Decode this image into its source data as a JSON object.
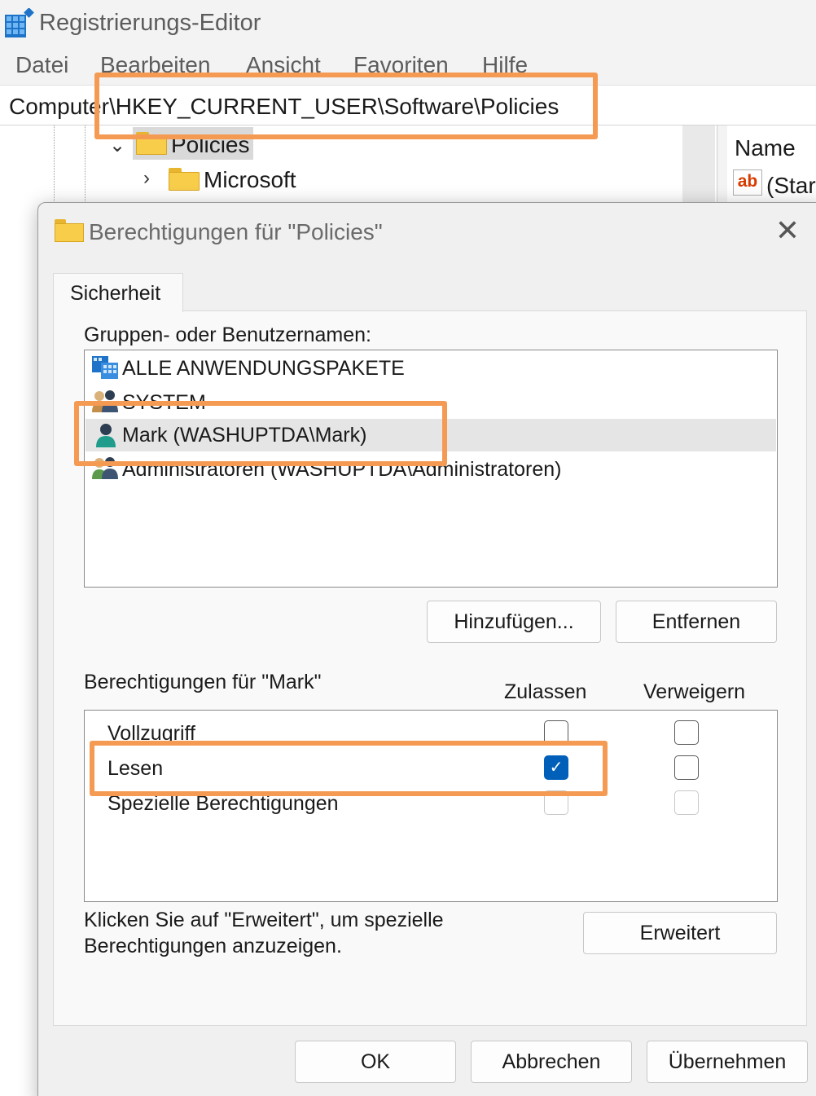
{
  "app": {
    "title": "Registrierungs-Editor",
    "menu": [
      "Datei",
      "Bearbeiten",
      "Ansicht",
      "Favoriten",
      "Hilfe"
    ],
    "address": "Computer\\HKEY_CURRENT_USER\\Software\\Policies"
  },
  "tree": {
    "selected_key": "Policies",
    "child_key": "Microsoft"
  },
  "values_pane": {
    "column_name": "Name",
    "first_value": "(Star"
  },
  "dialog": {
    "title": "Berechtigungen für \"Policies\"",
    "tab_security": "Sicherheit",
    "groups_label": "Gruppen- oder Benutzernamen:",
    "principals": [
      {
        "label": "ALLE ANWENDUNGSPAKETE",
        "icon": "app-package-icon"
      },
      {
        "label": "SYSTEM",
        "icon": "user-group-icon"
      },
      {
        "label": "Mark (WASHUPTDA\\Mark)",
        "icon": "user-icon",
        "selected": true
      },
      {
        "label": "Administratoren (WASHUPTDA\\Administratoren)",
        "icon": "user-group-icon"
      }
    ],
    "add_button": "Hinzufügen...",
    "remove_button": "Entfernen",
    "permissions_label": "Berechtigungen für \"Mark\"",
    "allow_header": "Zulassen",
    "deny_header": "Verweigern",
    "permissions": [
      {
        "label": "Vollzugriff",
        "allow": false,
        "deny": false,
        "disabled": false
      },
      {
        "label": "Lesen",
        "allow": true,
        "deny": false,
        "disabled": false
      },
      {
        "label": "Spezielle Berechtigungen",
        "allow": false,
        "deny": false,
        "disabled": true
      }
    ],
    "advanced_hint": [
      "Klicken Sie auf \"Erweitert\", um spezielle",
      "Berechtigungen anzuzeigen."
    ],
    "advanced_button": "Erweitert",
    "ok_button": "OK",
    "cancel_button": "Abbrechen",
    "apply_button": "Übernehmen"
  },
  "colors": {
    "highlight": "#f59a52",
    "checkbox_accent": "#005fb8"
  }
}
